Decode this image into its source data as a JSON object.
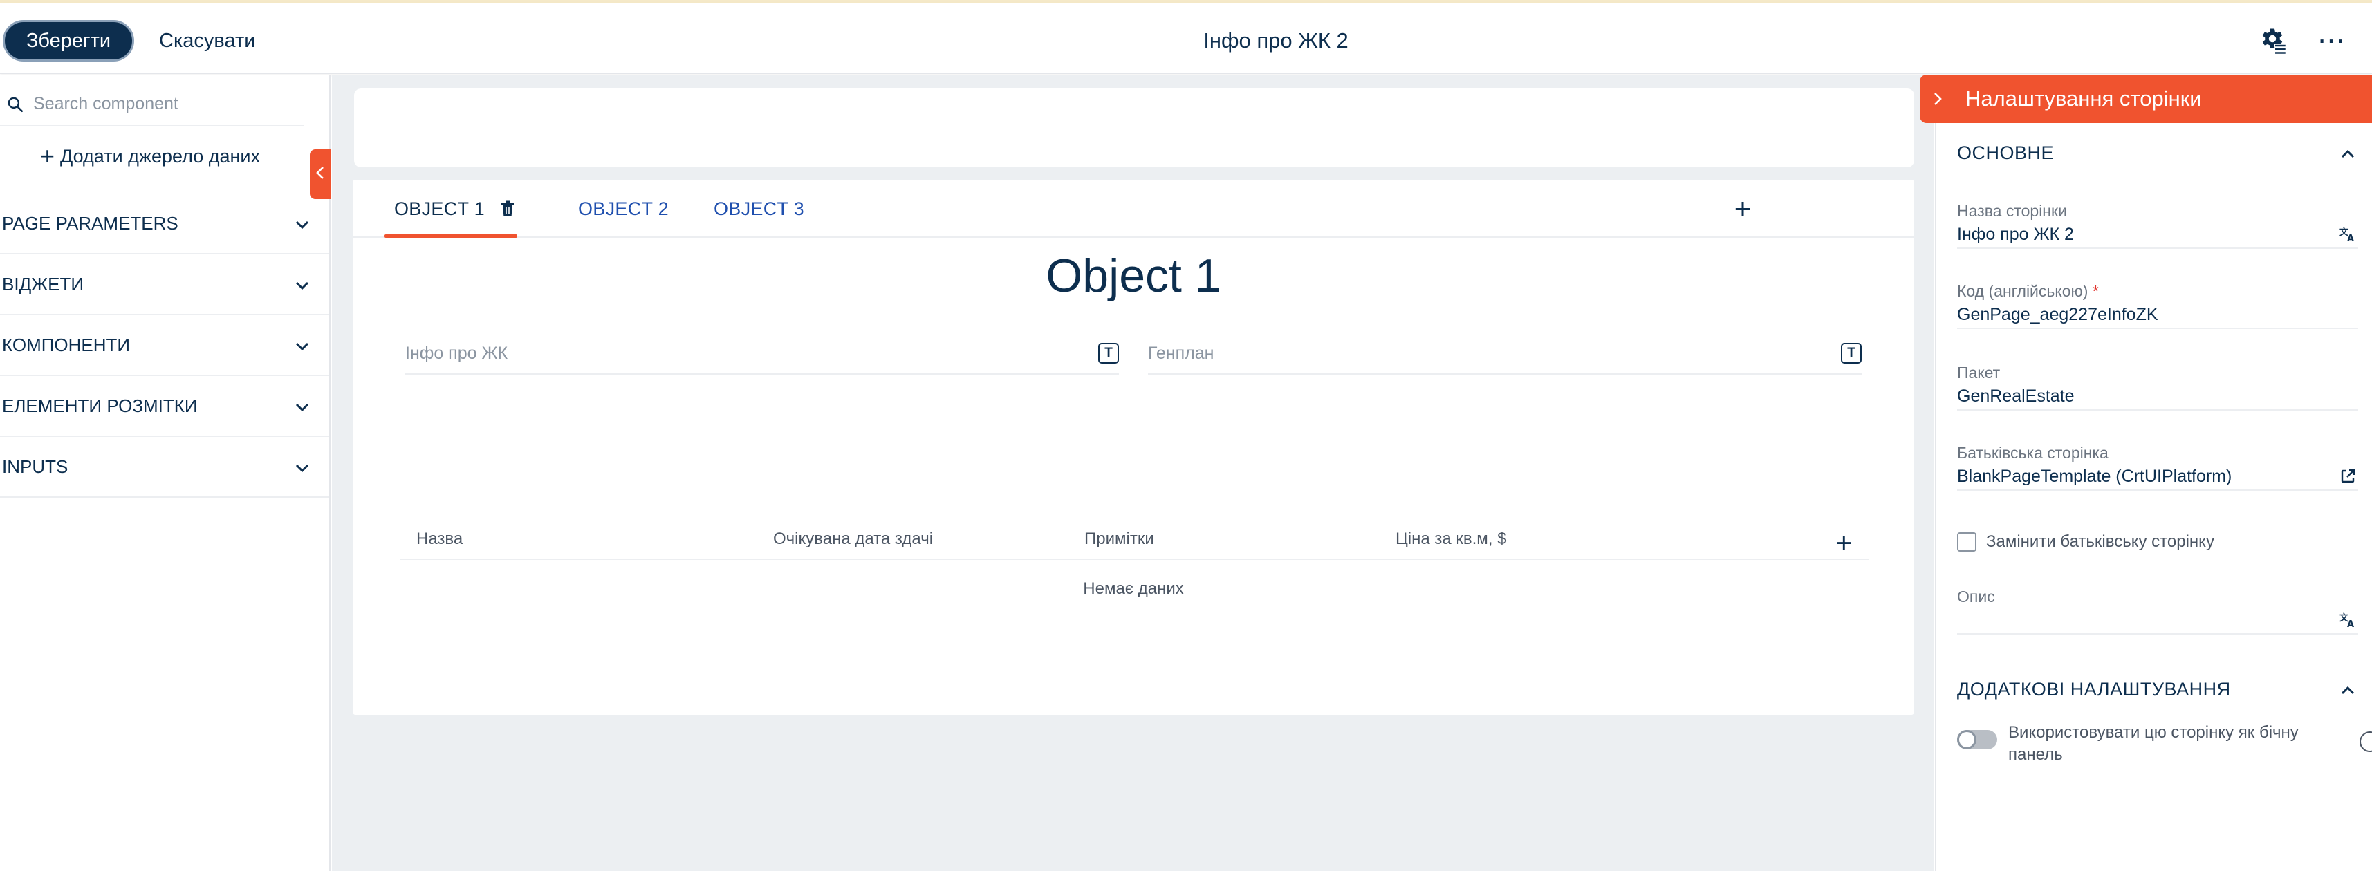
{
  "header": {
    "save_label": "Зберегти",
    "cancel_label": "Скасувати",
    "title": "Інфо про ЖК 2",
    "more_label": "⋯"
  },
  "left_panel": {
    "search_placeholder": "Search component",
    "add_source_label": "Додати джерело даних",
    "sections": [
      {
        "label": "PAGE PARAMETERS"
      },
      {
        "label": "ВІДЖЕТИ"
      },
      {
        "label": "КОМПОНЕНТИ"
      },
      {
        "label": "ЕЛЕМЕНТИ РОЗМІТКИ"
      },
      {
        "label": "INPUTS"
      }
    ]
  },
  "canvas": {
    "tabs": [
      {
        "label": "OBJECT 1",
        "active": true
      },
      {
        "label": "OBJECT 2",
        "active": false
      },
      {
        "label": "OBJECT 3",
        "active": false
      }
    ],
    "object_title": "Object 1",
    "fields": [
      {
        "label": "Інфо про ЖК"
      },
      {
        "label": "Генплан"
      }
    ],
    "table": {
      "columns": [
        "Назва",
        "Очікувана дата здачі",
        "Примітки",
        "Ціна за кв.м, $"
      ],
      "empty_text": "Немає даних"
    }
  },
  "right_panel": {
    "title": "Налаштування сторінки",
    "section_main": "ОСНОВНЕ",
    "fields": {
      "page_name": {
        "label": "Назва сторінки",
        "value": "Інфо про ЖК 2"
      },
      "code": {
        "label": "Код (англійською)",
        "required_mark": "*",
        "value": "GenPage_aeg227eInfoZK"
      },
      "package": {
        "label": "Пакет",
        "value": "GenRealEstate"
      },
      "parent": {
        "label": "Батьківська сторінка",
        "value": "BlankPageTemplate (CrtUIPlatform)"
      },
      "description": {
        "label": "Опис",
        "value": ""
      }
    },
    "replace_parent_label": "Замінити батьківську сторінку",
    "section_extra": "ДОДАТКОВІ НАЛАШТУВАННЯ",
    "sidebar_toggle_label": "Використовувати цю сторінку як бічну панель"
  },
  "colors": {
    "primary": "#0d2e4e",
    "accent": "#f0532f",
    "link": "#1f4fae",
    "canvas_bg": "#eceff2"
  }
}
